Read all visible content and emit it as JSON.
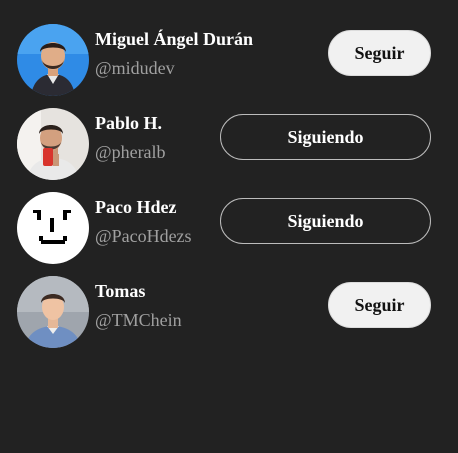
{
  "users": [
    {
      "name": "Miguel Ángel Durán",
      "handle": "@midudev",
      "button": "Seguir",
      "following": false,
      "avatar_icon": "avatar-photo-blue-background"
    },
    {
      "name": "Pablo H.",
      "handle": "@pheralb",
      "button": "Siguiendo",
      "following": true,
      "avatar_icon": "avatar-photo-selfie"
    },
    {
      "name": "Paco Hdez",
      "handle": "@PacoHdezs",
      "button": "Siguiendo",
      "following": true,
      "avatar_icon": "avatar-pixel-face"
    },
    {
      "name": "Tomas",
      "handle": "@TMChein",
      "button": "Seguir",
      "following": false,
      "avatar_icon": "avatar-photo-blue-shirt"
    }
  ],
  "colors": {
    "background": "#222222",
    "name_text": "#ffffff",
    "handle_text": "#a0a0a0",
    "follow_button_bg": "#f1f1f1",
    "follow_button_text": "#111111",
    "following_button_border": "#bcbcbc"
  }
}
